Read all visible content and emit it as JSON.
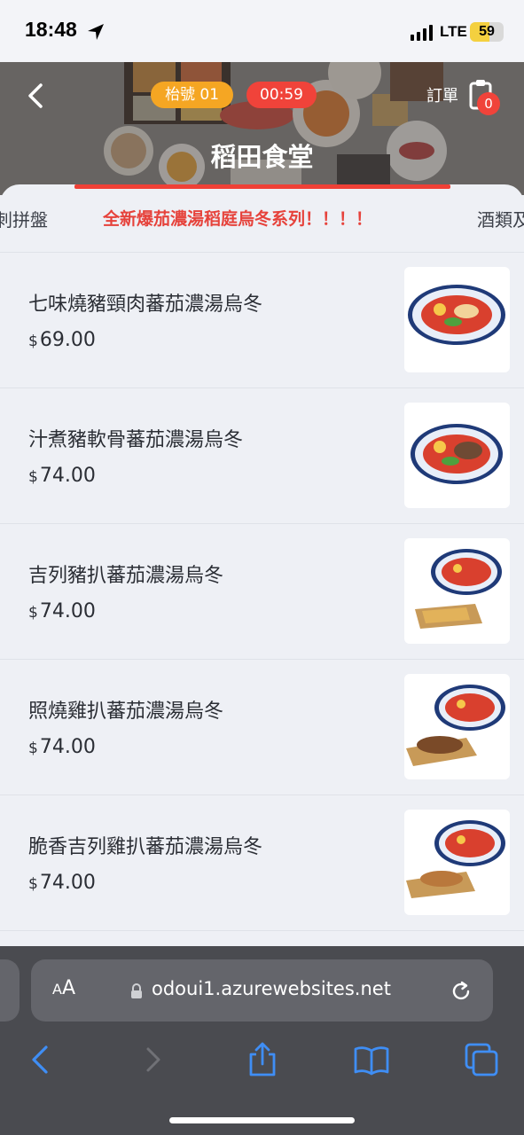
{
  "status_bar": {
    "time": "18:48",
    "network": "LTE",
    "battery": "59",
    "battery_level": 0.59,
    "icons": [
      "location-arrow-icon",
      "signal-bars-icon"
    ]
  },
  "header": {
    "table_badge": "枱號 01",
    "timer": "00:59",
    "shop_name": "稻田食堂",
    "order_label": "訂單",
    "order_count": "0",
    "icons": [
      "back-chevron-icon",
      "clipboard-icon"
    ]
  },
  "colors": {
    "accent_red": "#ef4036",
    "badge_orange": "#f5a623",
    "background": "#eef0f5",
    "browser_chrome": "#4a4b50",
    "toolbar_blue": "#3f8ef5"
  },
  "category_tabs": [
    "刺拼盤",
    "全新爆茄濃湯稻庭烏冬系列！！！！",
    "酒類及"
  ],
  "menu": {
    "currency": "$",
    "items": [
      {
        "name": "七味燒豬頸肉蕃茄濃湯烏冬",
        "price": "69.00"
      },
      {
        "name": "汁煮豬軟骨蕃茄濃湯烏冬",
        "price": "74.00"
      },
      {
        "name": "吉列豬扒蕃茄濃湯烏冬",
        "price": "74.00"
      },
      {
        "name": "照燒雞扒蕃茄濃湯烏冬",
        "price": "74.00"
      },
      {
        "name": "脆香吉列雞扒蕃茄濃湯烏冬",
        "price": "74.00"
      }
    ]
  },
  "browser": {
    "text_size_label_small": "A",
    "text_size_label_large": "A",
    "url": "odoui1.azurewebsites.net",
    "icons": [
      "lock-icon",
      "reload-icon",
      "back-icon",
      "forward-icon",
      "share-icon",
      "bookmarks-icon",
      "tabs-icon"
    ]
  }
}
